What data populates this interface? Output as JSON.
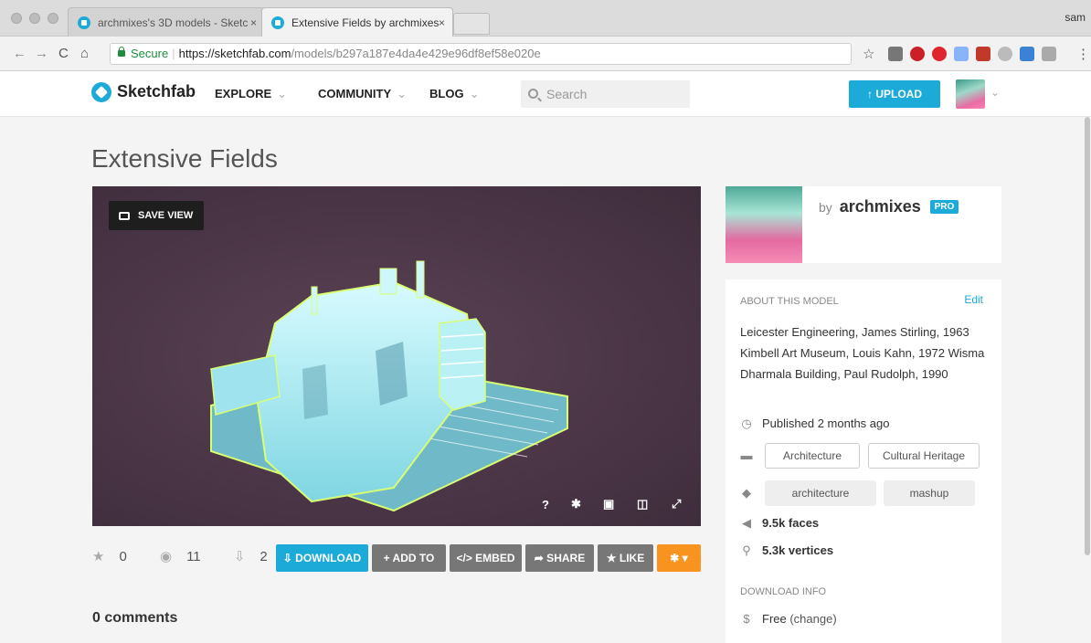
{
  "browser": {
    "tabs": [
      {
        "title": "archmixes's 3D models - Sketc",
        "close": "×"
      },
      {
        "title": "Extensive Fields by archmixes",
        "close": "×"
      }
    ],
    "profile": "sam",
    "secure_label": "Secure",
    "url_host": "https://sketchfab.com",
    "url_path": "/models/b297a187e4da4e429e96df8ef58e020e",
    "nav": {
      "back": "←",
      "forward": "→",
      "reload": "C",
      "home": "⌂",
      "star": "☆",
      "menu": "⋮"
    }
  },
  "header": {
    "brand": "Sketchfab",
    "menu": [
      {
        "label": "EXPLORE",
        "chev": "⌄"
      },
      {
        "label": "COMMUNITY",
        "chev": "⌄"
      },
      {
        "label": "BLOG",
        "chev": "⌄"
      }
    ],
    "search_placeholder": "Search",
    "upload_label": "↑  UPLOAD",
    "avatar_chev": "⌄"
  },
  "model": {
    "title": "Extensive Fields",
    "save_view": "SAVE VIEW",
    "viewer_controls": [
      "?",
      "✱",
      "▣",
      "◫",
      "⤢"
    ],
    "stats": {
      "stars": "0",
      "views": "11",
      "downloads": "2"
    },
    "stat_icons": {
      "star": "★",
      "eye": "◉",
      "download": "⇩"
    },
    "actions": {
      "download": "⇩  DOWNLOAD",
      "add_to": "+  ADD TO",
      "embed": "</>  EMBED",
      "share": "➦  SHARE",
      "like": "★  LIKE",
      "settings": "✱  ▾"
    },
    "comments": "0 comments"
  },
  "author": {
    "by": "by",
    "name": "archmixes",
    "badge": "PRO"
  },
  "about": {
    "label": "ABOUT THIS MODEL",
    "edit": "Edit",
    "description": "Leicester Engineering, James Stirling, 1963 Kimbell Art Museum, Louis Kahn, 1972 Wisma Dharmala Building, Paul Rudolph, 1990",
    "published": "Published 2 months ago",
    "categories": [
      "Architecture",
      "Cultural Heritage"
    ],
    "tags": [
      "architecture",
      "mashup"
    ],
    "faces": "9.5k faces",
    "vertices": "5.3k vertices",
    "download_label": "DOWNLOAD INFO",
    "price_prefix": "Free",
    "price_link": " (change)",
    "icons": {
      "clock": "◷",
      "folder": "▬",
      "tag": "◆",
      "faces": "◀",
      "vertices": "⚲",
      "dollar": "$"
    }
  },
  "colors": {
    "accent": "#1caad9",
    "orange": "#f7931e",
    "grey_button": "#777777",
    "viewer_bg": "#4a3546"
  }
}
